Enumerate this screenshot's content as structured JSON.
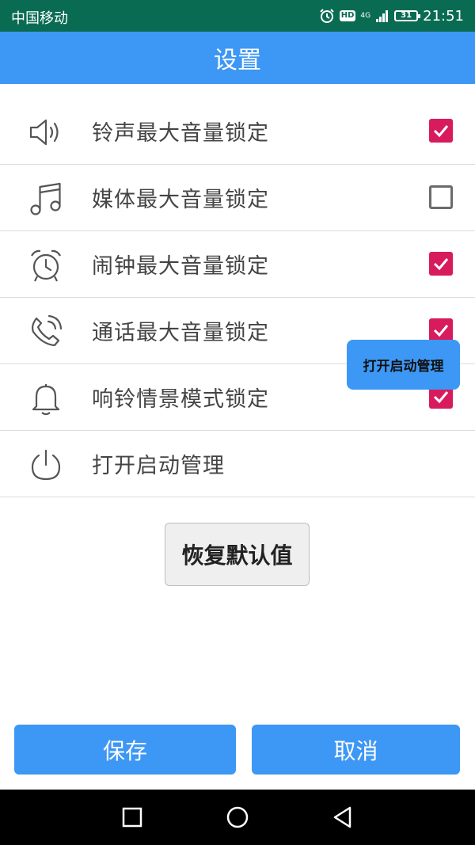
{
  "status_bar": {
    "carrier": "中国移动",
    "hd": "HD",
    "network": "4G",
    "battery": "31",
    "time": "21:51"
  },
  "header": {
    "title": "设置"
  },
  "settings": [
    {
      "icon": "speaker-icon",
      "label": "铃声最大音量锁定",
      "checked": true
    },
    {
      "icon": "music-note-icon",
      "label": "媒体最大音量锁定",
      "checked": false
    },
    {
      "icon": "alarm-clock-icon",
      "label": "闹钟最大音量锁定",
      "checked": true
    },
    {
      "icon": "phone-ringing-icon",
      "label": "通话最大音量锁定",
      "checked": true
    },
    {
      "icon": "bell-icon",
      "label": "响铃情景模式锁定",
      "checked": true
    },
    {
      "icon": "power-icon",
      "label": "打开启动管理",
      "button_label": "打开启动管理"
    }
  ],
  "restore_button": {
    "label": "恢复默认值"
  },
  "footer": {
    "save_label": "保存",
    "cancel_label": "取消"
  },
  "colors": {
    "accent": "#3d97f4",
    "status_bar": "#0a6b53",
    "checkbox_on": "#d81b5d"
  }
}
